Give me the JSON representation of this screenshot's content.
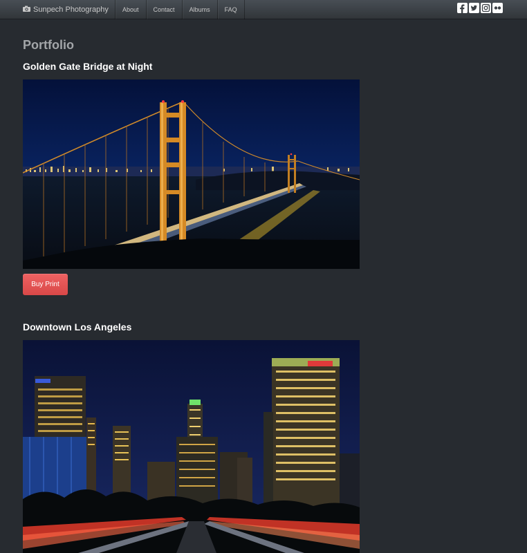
{
  "navbar": {
    "brand": "Sunpech Photography",
    "brand_icon": "camera-icon",
    "items": [
      {
        "label": "About"
      },
      {
        "label": "Contact"
      },
      {
        "label": "Albums"
      },
      {
        "label": "FAQ"
      }
    ],
    "social": [
      "facebook-icon",
      "twitter-icon",
      "instagram-icon",
      "flickr-icon"
    ]
  },
  "main": {
    "heading": "Portfolio",
    "photos": [
      {
        "title": "Golden Gate Bridge at Night",
        "button": "Buy Print"
      },
      {
        "title": "Downtown Los Angeles"
      }
    ]
  },
  "colors": {
    "background": "#272b30",
    "navbar": "#3a3f44",
    "button": "#ee5f5b",
    "heading": "#a3a6a9"
  }
}
